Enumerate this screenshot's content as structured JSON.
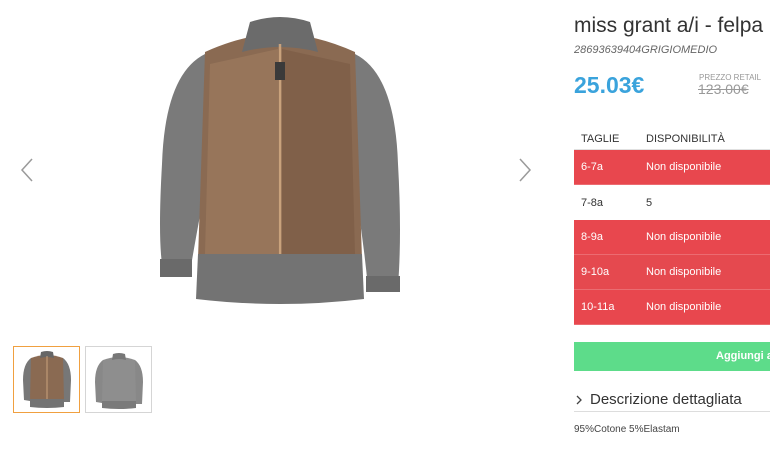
{
  "product": {
    "title": "miss grant a/i - felpa",
    "sku": "28693639404GRIGIOMEDIO",
    "price": "25.03€",
    "retail_label": "PREZZO RETAIL",
    "retail_price": "123.00€"
  },
  "sizes": {
    "header_size": "TAGLIE",
    "header_availability": "DISPONIBILITÀ",
    "rows": [
      {
        "size": "6-7a",
        "availability": "Non disponibile",
        "available": false
      },
      {
        "size": "7-8a",
        "availability": "5",
        "available": true
      },
      {
        "size": "8-9a",
        "availability": "Non disponibile",
        "available": false
      },
      {
        "size": "9-10a",
        "availability": "Non disponibile",
        "available": false
      },
      {
        "size": "10-11a",
        "availability": "Non disponibile",
        "available": false
      }
    ]
  },
  "cart": {
    "add_label": "Aggiungi a"
  },
  "description": {
    "toggle_label": "Descrizione dettagliata",
    "composition": "95%Cotone 5%Elastam"
  },
  "gallery": {
    "icons": {
      "prev": "chevron-left-icon",
      "next": "chevron-right-icon",
      "toggle": "chevron-right-icon"
    },
    "thumbnail_count": 2,
    "active_thumbnail": 0
  },
  "colors": {
    "price": "#3aa3dc",
    "unavailable": "#e8474e",
    "add_button": "#5ddc8a",
    "active_thumb": "#f0a040"
  }
}
